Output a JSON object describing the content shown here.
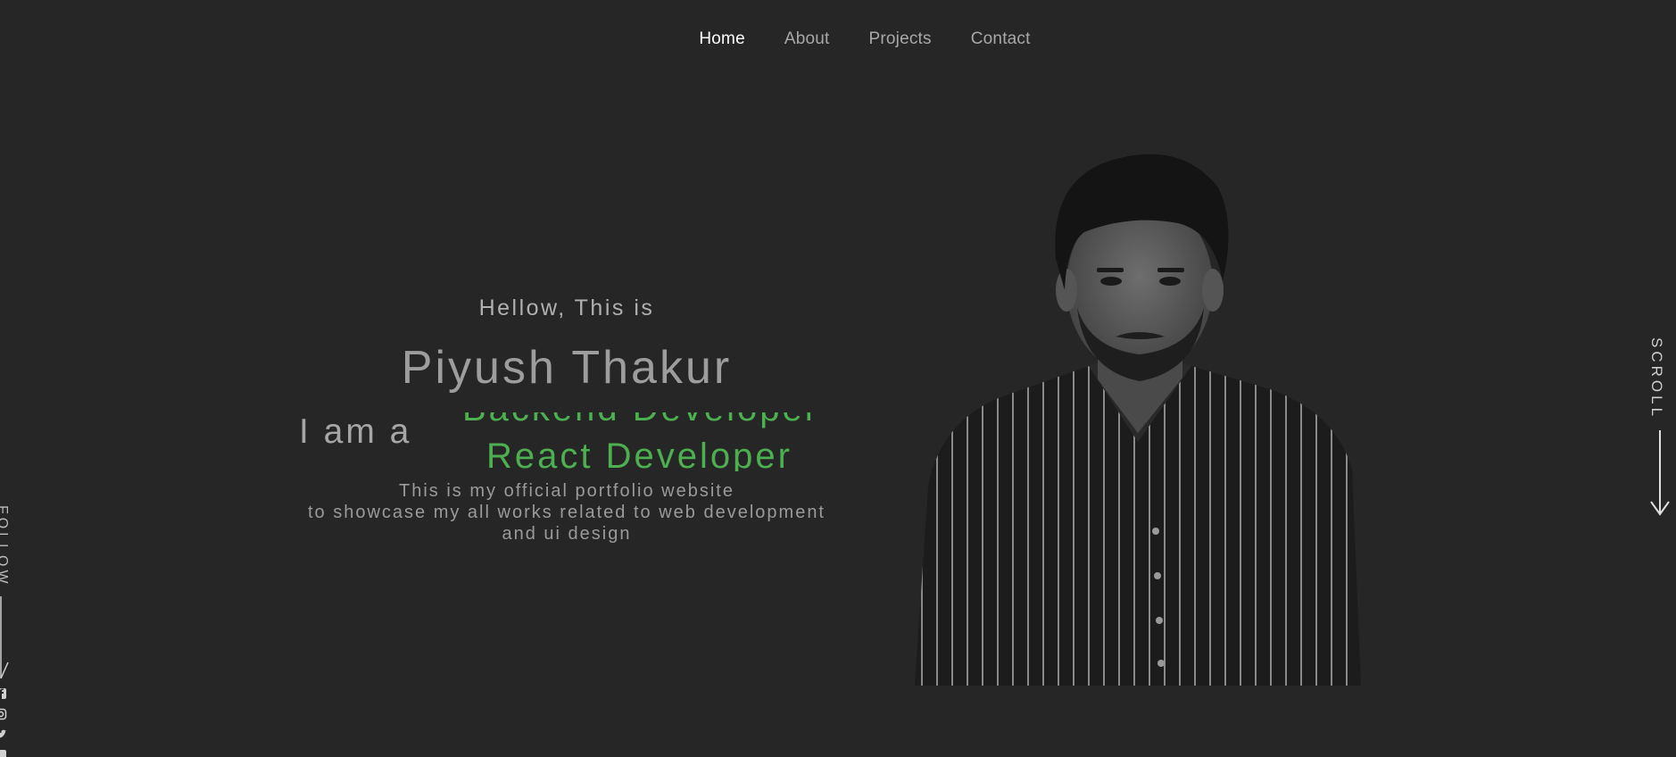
{
  "nav": {
    "items": [
      {
        "label": "Home",
        "active": true
      },
      {
        "label": "About",
        "active": false
      },
      {
        "label": "Projects",
        "active": false
      },
      {
        "label": "Contact",
        "active": false
      }
    ]
  },
  "hero": {
    "greeting": "Hellow, This is",
    "name": "Piyush Thakur",
    "intro": "I am a",
    "role_previous": "Backend Developer",
    "role_current": "React Developer",
    "description_lines": [
      "This is my official portfolio website",
      "to showcase my all works related to web development",
      "and ui design"
    ]
  },
  "scroll": {
    "label": "SCROLL"
  },
  "follow": {
    "label": "FOLLOW",
    "icons": [
      "facebook-icon",
      "instagram-icon",
      "twitter-icon",
      "linkedin-icon"
    ]
  },
  "colors": {
    "background": "#262626",
    "accent": "#4caf50",
    "nav_active": "#ffffff",
    "text": "#9a9a9a"
  }
}
